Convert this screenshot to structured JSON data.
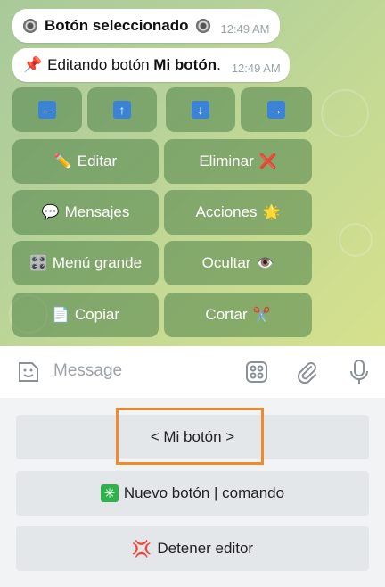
{
  "messages": [
    {
      "text": "Botón seleccionado",
      "time": "12:49 AM"
    },
    {
      "prefix": "Editando botón ",
      "bold": "Mi botón",
      "suffix": ".",
      "time": "12:49 AM"
    }
  ],
  "inline_keyboard": {
    "arrows": [
      "←",
      "↑",
      "↓",
      "→"
    ],
    "rows": [
      [
        {
          "label": "Editar",
          "icon": "pencil-icon"
        },
        {
          "label": "Eliminar",
          "icon": "cross-icon"
        }
      ],
      [
        {
          "label": "Mensajes",
          "icon": "speech-bubble-icon"
        },
        {
          "label": "Acciones",
          "icon": "sparkle-icon"
        }
      ],
      [
        {
          "label": "Menú grande",
          "icon": "control-knobs-icon"
        },
        {
          "label": "Ocultar",
          "icon": "eye-icon"
        }
      ],
      [
        {
          "label": "Copiar",
          "icon": "page-icon"
        },
        {
          "label": "Cortar",
          "icon": "scissors-icon"
        }
      ]
    ]
  },
  "composer": {
    "placeholder": "Message"
  },
  "reply_keyboard": {
    "buttons": [
      {
        "label": "< Mi botón >"
      },
      {
        "label": "Nuevo botón | comando",
        "icon": "sparkle-square-icon"
      },
      {
        "label": "Detener editor",
        "icon": "anger-icon"
      }
    ]
  },
  "colors": {
    "highlight": "#f08a2c",
    "inline_button": "#4e8248",
    "arrow_icon": "#3b83d6"
  }
}
